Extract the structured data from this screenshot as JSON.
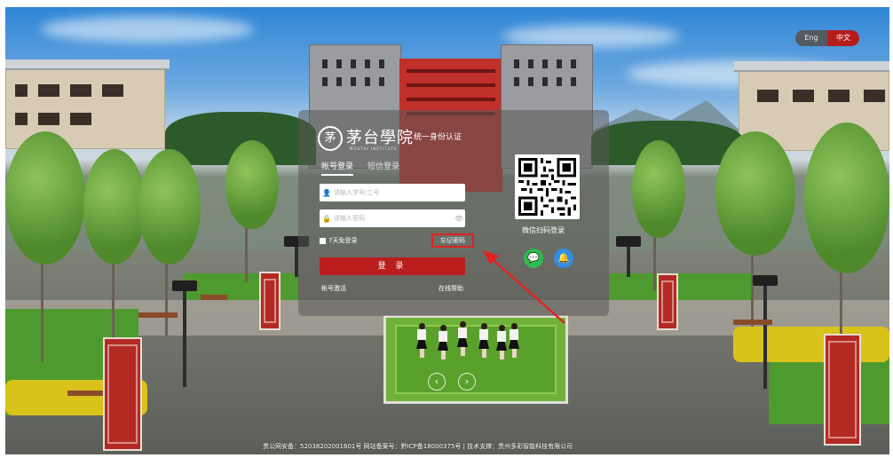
{
  "lang_switch": {
    "eng": "Eng",
    "zh": "中文"
  },
  "logo": {
    "seal_glyph": "茅",
    "name": "茅台學院",
    "english": "MOUTAI INSTITUTE",
    "subtitle": "统一身份认证"
  },
  "tabs": [
    {
      "label": "帐号登录",
      "active": true
    },
    {
      "label": "短信登录",
      "active": false
    }
  ],
  "form": {
    "username_placeholder": "请输入学号/工号",
    "password_placeholder": "请输入密码",
    "remember_label": "7天免登录",
    "forgot_label": "忘记密码",
    "login_label": "登 录",
    "activate_label": "帐号激活",
    "help_label": "在线帮助"
  },
  "qr": {
    "label": "微信扫码登录"
  },
  "social": {
    "wechat_icon": "wechat-icon",
    "bell_icon": "bell-icon"
  },
  "footer": "贵公网安备：52038202001601号  网站备案号：黔ICP备18000375号  |  技术支撑：贵州多彩智能科技有限公司",
  "colors": {
    "accent": "#b91d1d",
    "highlight": "#e0231f",
    "wechat": "#2fbb4f",
    "bell": "#2f8ee8"
  }
}
